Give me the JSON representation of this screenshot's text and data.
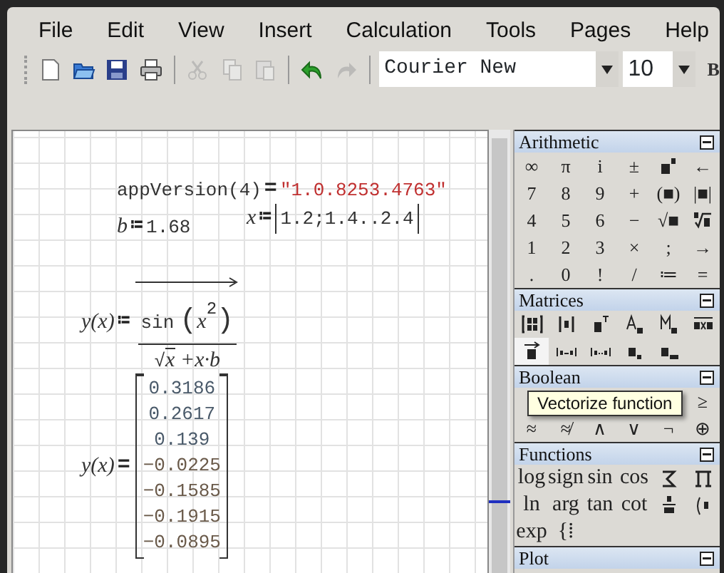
{
  "menu": [
    "File",
    "Edit",
    "View",
    "Insert",
    "Calculation",
    "Tools",
    "Pages",
    "Help"
  ],
  "toolbar": {
    "buttons": [
      {
        "kind": "new",
        "disabled": false
      },
      {
        "kind": "open",
        "disabled": false
      },
      {
        "kind": "save",
        "disabled": false
      },
      {
        "kind": "print",
        "disabled": false
      },
      {
        "kind": "sep"
      },
      {
        "kind": "cut",
        "disabled": true
      },
      {
        "kind": "copy",
        "disabled": true
      },
      {
        "kind": "paste",
        "disabled": true
      },
      {
        "kind": "sep"
      },
      {
        "kind": "undo",
        "disabled": false
      },
      {
        "kind": "redo",
        "disabled": true
      }
    ],
    "font": "Courier New",
    "size": "10",
    "bold": "B"
  },
  "worksheet": {
    "regions": [
      {
        "kind": "eval_string",
        "lhs": "appVersion(4)",
        "op": "=",
        "value": "\"1.0.8253.4763\""
      },
      {
        "kind": "define",
        "name": "b",
        "op": "≔",
        "value": "1.68"
      },
      {
        "kind": "define_list",
        "name": "x",
        "op": "≔",
        "value": "1.2;1.4..2.4"
      },
      {
        "kind": "function_def",
        "lhs": "y(x)",
        "op": "≔",
        "fn": "sin",
        "open": "(",
        "close": ")",
        "radical": "√",
        "base": "x",
        "exponent": "2",
        "root": "x",
        "rest": "+x·b"
      },
      {
        "kind": "eval_vector",
        "lhs": "y(x)",
        "op": "=",
        "values": [
          "0.3186",
          "0.2617",
          "0.139",
          "−0.0225",
          "−0.1585",
          "−0.1915",
          "−0.0895"
        ]
      }
    ]
  },
  "panels": [
    {
      "title": "Arithmetic",
      "rows": [
        [
          {
            "kind": "text",
            "label": "∞"
          },
          {
            "kind": "text",
            "label": "π"
          },
          {
            "kind": "text",
            "label": "i"
          },
          {
            "kind": "text",
            "label": "±"
          },
          {
            "kind": "icon"
          },
          {
            "kind": "text",
            "label": "←"
          }
        ],
        [
          {
            "kind": "text",
            "label": "7"
          },
          {
            "kind": "text",
            "label": "8"
          },
          {
            "kind": "text",
            "label": "9"
          },
          {
            "kind": "text",
            "label": "+"
          },
          {
            "kind": "text",
            "label": "(■)"
          },
          {
            "kind": "text",
            "label": "|■|"
          }
        ],
        [
          {
            "kind": "text",
            "label": "4"
          },
          {
            "kind": "text",
            "label": "5"
          },
          {
            "kind": "text",
            "label": "6"
          },
          {
            "kind": "text",
            "label": "−"
          },
          {
            "kind": "text",
            "label": "√■"
          },
          {
            "kind": "icon"
          }
        ],
        [
          {
            "kind": "text",
            "label": "1"
          },
          {
            "kind": "text",
            "label": "2"
          },
          {
            "kind": "text",
            "label": "3"
          },
          {
            "kind": "text",
            "label": "×"
          },
          {
            "kind": "text",
            "label": ";"
          },
          {
            "kind": "text",
            "label": "→"
          }
        ],
        [
          {
            "kind": "text",
            "label": "."
          },
          {
            "kind": "text",
            "label": "0"
          },
          {
            "kind": "text",
            "label": "!"
          },
          {
            "kind": "text",
            "label": "/"
          },
          {
            "kind": "text",
            "label": "≔"
          },
          {
            "kind": "text",
            "label": "="
          }
        ]
      ]
    },
    {
      "title": "Matrices",
      "rows": [
        [
          {
            "kind": "icon",
            "hovered": false
          },
          {
            "kind": "icon",
            "hovered": false
          },
          {
            "kind": "icon",
            "hovered": false
          },
          {
            "kind": "icon",
            "hovered": false
          },
          {
            "kind": "icon",
            "hovered": false
          },
          {
            "kind": "icon",
            "hovered": false
          }
        ],
        [
          {
            "kind": "icon",
            "hovered": true
          },
          {
            "kind": "icon",
            "hovered": false
          },
          {
            "kind": "icon",
            "hovered": false
          },
          {
            "kind": "icon",
            "hovered": false
          },
          {
            "kind": "icon",
            "hovered": false
          }
        ]
      ],
      "tooltip": "Vectorize function"
    },
    {
      "title": "Boolean",
      "rows": [
        [
          {
            "kind": "hidden"
          },
          {
            "kind": "hidden"
          },
          {
            "kind": "hidden"
          },
          {
            "kind": "hidden"
          },
          {
            "kind": "hidden"
          },
          {
            "kind": "text",
            "label": "≥"
          }
        ],
        [
          {
            "kind": "text",
            "label": "≈"
          },
          {
            "kind": "text",
            "label": "≉"
          },
          {
            "kind": "text",
            "label": "∧"
          },
          {
            "kind": "text",
            "label": "∨"
          },
          {
            "kind": "text",
            "label": "¬"
          },
          {
            "kind": "text",
            "label": "⊕"
          }
        ]
      ]
    },
    {
      "title": "Functions",
      "rows": [
        [
          {
            "kind": "word",
            "label": "log"
          },
          {
            "kind": "word",
            "label": "sign"
          },
          {
            "kind": "word",
            "label": "sin"
          },
          {
            "kind": "word",
            "label": "cos"
          },
          {
            "kind": "icon"
          },
          {
            "kind": "icon"
          }
        ],
        [
          {
            "kind": "word",
            "label": "ln"
          },
          {
            "kind": "word",
            "label": "arg"
          },
          {
            "kind": "word",
            "label": "tan"
          },
          {
            "kind": "word",
            "label": "cot"
          },
          {
            "kind": "icon"
          },
          {
            "kind": "icon"
          }
        ],
        [
          {
            "kind": "word",
            "label": "exp"
          },
          {
            "kind": "word",
            "label": "{⁞"
          }
        ]
      ]
    },
    {
      "title": "Plot"
    }
  ]
}
